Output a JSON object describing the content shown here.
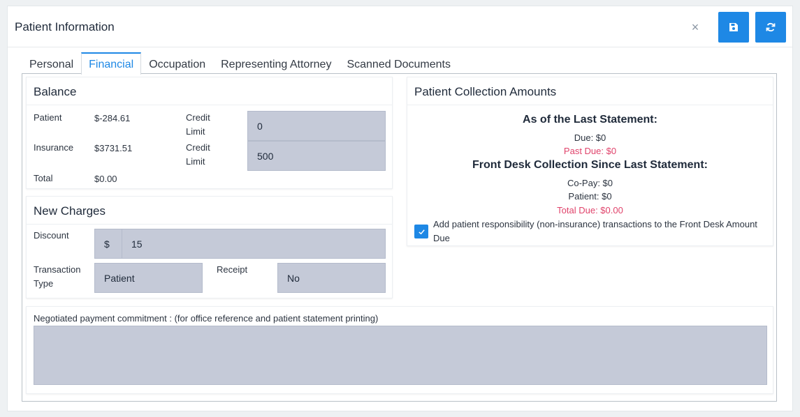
{
  "header": {
    "title": "Patient Information",
    "close_glyph": "×",
    "save_icon": "save-icon",
    "refresh_icon": "refresh-icon",
    "accent": "#1e88e5"
  },
  "tabs": [
    {
      "label": "Personal",
      "active": false
    },
    {
      "label": "Financial",
      "active": true
    },
    {
      "label": "Occupation",
      "active": false
    },
    {
      "label": "Representing Attorney",
      "active": false
    },
    {
      "label": "Scanned Documents",
      "active": false
    }
  ],
  "balance": {
    "title": "Balance",
    "patient_label": "Patient",
    "patient_value": "$-284.61",
    "insurance_label": "Insurance",
    "insurance_value": "$3731.51",
    "total_label": "Total",
    "total_value": "$0.00",
    "credit_limit_label_1": "Credit Limit",
    "credit_limit_value_1": "0",
    "credit_limit_label_2": "Credit Limit",
    "credit_limit_value_2": "500"
  },
  "new_charges": {
    "title": "New Charges",
    "discount_label": "Discount",
    "discount_prefix": "$",
    "discount_value": "15",
    "transaction_type_label": "Transaction Type",
    "transaction_type_value": "Patient",
    "receipt_label": "Receipt",
    "receipt_value": "No"
  },
  "collection": {
    "title": "Patient Collection Amounts",
    "last_statement_heading": "As of the Last Statement:",
    "due_line": "Due: $0",
    "past_due_line": "Past Due: $0",
    "front_desk_heading": "Front Desk Collection Since Last Statement:",
    "copay_line": "Co-Pay: $0",
    "patient_line": "Patient: $0",
    "total_due_line": "Total Due: $0.00",
    "checkbox_label": "Add patient responsibility (non-insurance) transactions to the Front Desk Amount Due",
    "checkbox_checked": true,
    "red_color": "#e0436b"
  },
  "commitment": {
    "label": "Negotiated payment commitment : (for office reference and patient statement printing)",
    "value": ""
  }
}
